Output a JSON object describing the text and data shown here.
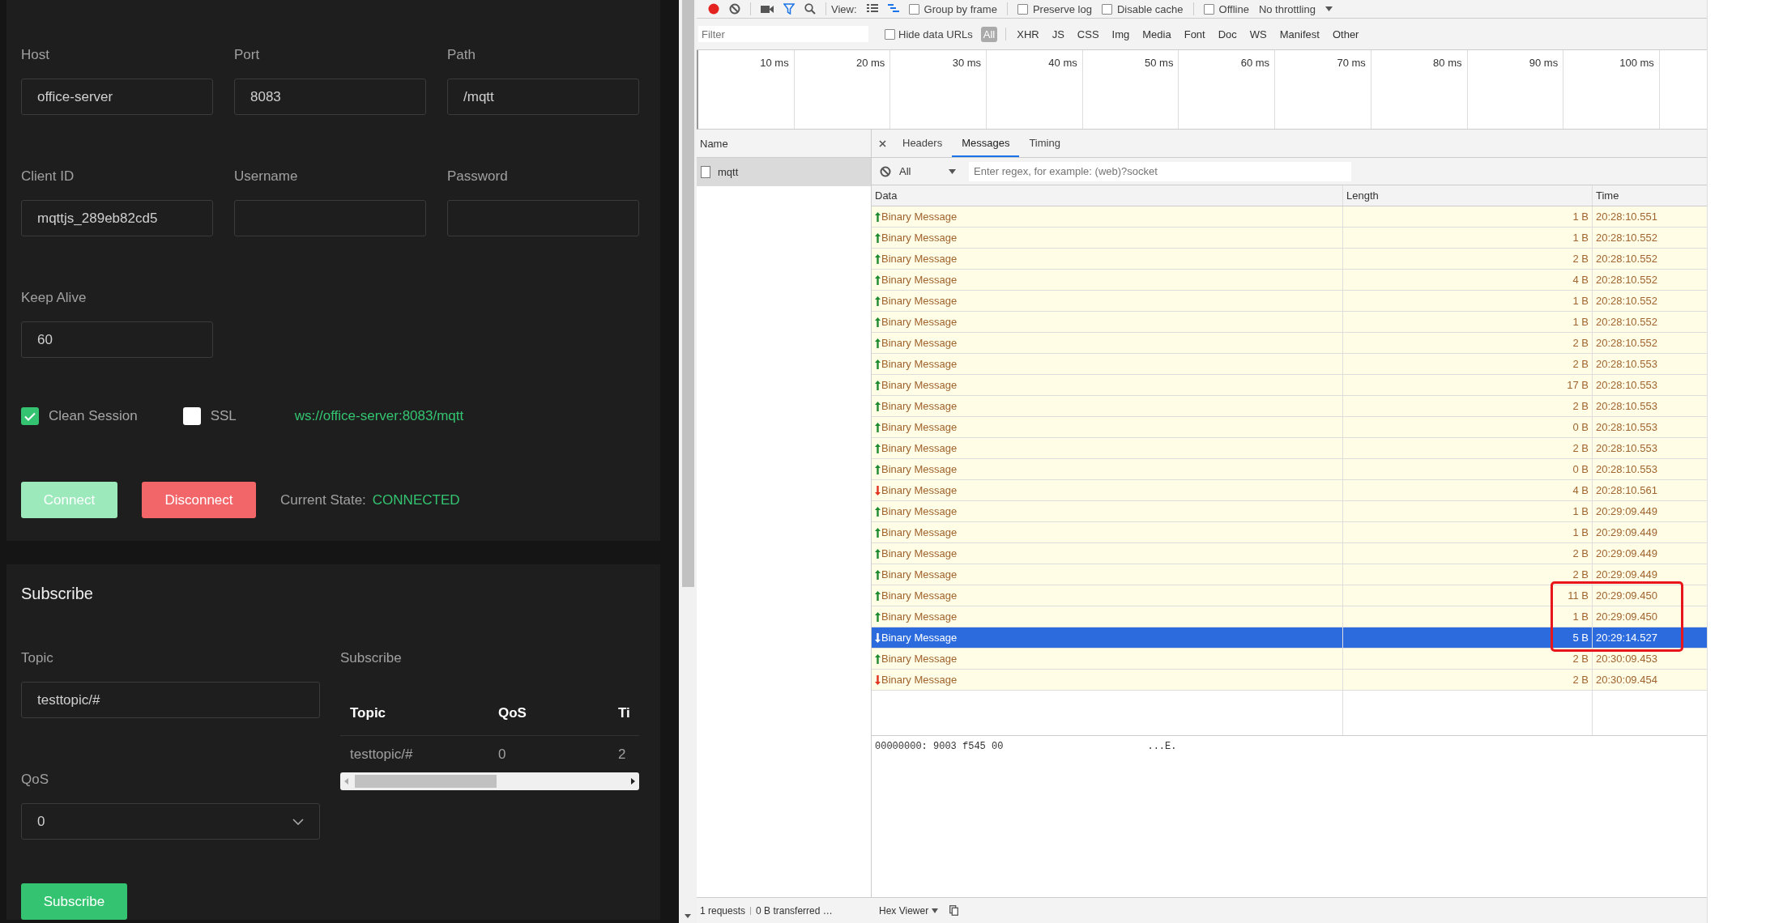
{
  "connection": {
    "fields": [
      {
        "label": "Host",
        "value": "office-server"
      },
      {
        "label": "Port",
        "value": "8083"
      },
      {
        "label": "Path",
        "value": "/mqtt"
      },
      {
        "label": "Client ID",
        "value": "mqttjs_289eb82cd5"
      },
      {
        "label": "Username"
      },
      {
        "label": "Password"
      },
      {
        "label": "Keep Alive",
        "value": "60"
      }
    ],
    "options": [
      {
        "label": "Clean Session",
        "checked": true
      },
      {
        "label": "SSL",
        "checked": false
      }
    ],
    "url": "ws://office-server:8083/mqtt",
    "buttons": [
      {
        "label": "Connect",
        "kind": "connect",
        "disabled": true
      },
      {
        "label": "Disconnect",
        "kind": "disconnect",
        "disabled": false
      }
    ],
    "state_label": "Current State:",
    "state": "CONNECTED"
  },
  "subscribe": {
    "title": "Subscribe",
    "topic": {
      "label": "Topic",
      "value": "testtopic/#"
    },
    "qos": {
      "label": "QoS",
      "value": "0"
    },
    "button": "Subscribe",
    "list": {
      "title": "Subscribe",
      "columns": [
        "Topic",
        "QoS",
        "Ti"
      ],
      "rows": [
        [
          "testtopic/#",
          "0",
          "2"
        ]
      ]
    }
  },
  "devtools": {
    "toolbar": {
      "recording": true,
      "view_label": "View:",
      "options": [
        {
          "label": "Group by frame",
          "checked": false
        },
        {
          "label": "Preserve log",
          "checked": false
        },
        {
          "label": "Disable cache",
          "checked": false
        },
        {
          "label": "Offline",
          "checked": false
        }
      ],
      "throttling": "No throttling"
    },
    "filter": {
      "placeholder": "Filter",
      "hide_data_urls": {
        "label": "Hide data URLs",
        "checked": false
      },
      "types": [
        {
          "label": "All",
          "selected": true
        },
        {
          "label": "XHR",
          "selected": false
        },
        {
          "label": "JS",
          "selected": false
        },
        {
          "label": "CSS",
          "selected": false
        },
        {
          "label": "Img",
          "selected": false
        },
        {
          "label": "Media",
          "selected": false
        },
        {
          "label": "Font",
          "selected": false
        },
        {
          "label": "Doc",
          "selected": false
        },
        {
          "label": "WS",
          "selected": false
        },
        {
          "label": "Manifest",
          "selected": false
        },
        {
          "label": "Other",
          "selected": false
        }
      ]
    },
    "timeline": {
      "ticks": [
        "10 ms",
        "20 ms",
        "30 ms",
        "40 ms",
        "50 ms",
        "60 ms",
        "70 ms",
        "80 ms",
        "90 ms",
        "100 ms"
      ]
    },
    "requests": {
      "column": "Name",
      "items": [
        {
          "name": "mqtt",
          "selected": true
        }
      ]
    },
    "tabs": [
      {
        "label": "Headers",
        "selected": false
      },
      {
        "label": "Messages",
        "selected": true
      },
      {
        "label": "Timing",
        "selected": false
      }
    ],
    "message_filter": {
      "type": "All",
      "placeholder": "Enter regex, for example: (web)?socket"
    },
    "columns": [
      "Data",
      "Length",
      "Time"
    ],
    "messages": [
      {
        "kind": "up",
        "data": "Binary Message",
        "length": "1 B",
        "time": "20:28:10.551",
        "selected": false,
        "marked": false
      },
      {
        "kind": "up",
        "data": "Binary Message",
        "length": "1 B",
        "time": "20:28:10.552",
        "selected": false,
        "marked": false
      },
      {
        "kind": "up",
        "data": "Binary Message",
        "length": "2 B",
        "time": "20:28:10.552",
        "selected": false,
        "marked": false
      },
      {
        "kind": "up",
        "data": "Binary Message",
        "length": "4 B",
        "time": "20:28:10.552",
        "selected": false,
        "marked": false
      },
      {
        "kind": "up",
        "data": "Binary Message",
        "length": "1 B",
        "time": "20:28:10.552",
        "selected": false,
        "marked": false
      },
      {
        "kind": "up",
        "data": "Binary Message",
        "length": "1 B",
        "time": "20:28:10.552",
        "selected": false,
        "marked": false
      },
      {
        "kind": "up",
        "data": "Binary Message",
        "length": "2 B",
        "time": "20:28:10.552",
        "selected": false,
        "marked": false
      },
      {
        "kind": "up",
        "data": "Binary Message",
        "length": "2 B",
        "time": "20:28:10.553",
        "selected": false,
        "marked": false
      },
      {
        "kind": "up",
        "data": "Binary Message",
        "length": "17 B",
        "time": "20:28:10.553",
        "selected": false,
        "marked": false
      },
      {
        "kind": "up",
        "data": "Binary Message",
        "length": "2 B",
        "time": "20:28:10.553",
        "selected": false,
        "marked": false
      },
      {
        "kind": "up",
        "data": "Binary Message",
        "length": "0 B",
        "time": "20:28:10.553",
        "selected": false,
        "marked": false
      },
      {
        "kind": "up",
        "data": "Binary Message",
        "length": "2 B",
        "time": "20:28:10.553",
        "selected": false,
        "marked": false
      },
      {
        "kind": "up",
        "data": "Binary Message",
        "length": "0 B",
        "time": "20:28:10.553",
        "selected": false,
        "marked": false
      },
      {
        "kind": "down",
        "data": "Binary Message",
        "length": "4 B",
        "time": "20:28:10.561",
        "selected": false,
        "marked": false
      },
      {
        "kind": "up",
        "data": "Binary Message",
        "length": "1 B",
        "time": "20:29:09.449",
        "selected": false,
        "marked": false
      },
      {
        "kind": "up",
        "data": "Binary Message",
        "length": "1 B",
        "time": "20:29:09.449",
        "selected": false,
        "marked": false
      },
      {
        "kind": "up",
        "data": "Binary Message",
        "length": "2 B",
        "time": "20:29:09.449",
        "selected": false,
        "marked": false
      },
      {
        "kind": "up",
        "data": "Binary Message",
        "length": "2 B",
        "time": "20:29:09.449",
        "selected": false,
        "marked": false
      },
      {
        "kind": "up",
        "data": "Binary Message",
        "length": "11 B",
        "time": "20:29:09.450",
        "selected": false,
        "marked": true
      },
      {
        "kind": "up",
        "data": "Binary Message",
        "length": "1 B",
        "time": "20:29:09.450",
        "selected": false,
        "marked": true
      },
      {
        "kind": "down",
        "data": "Binary Message",
        "length": "5 B",
        "time": "20:29:14.527",
        "selected": true,
        "marked": true
      },
      {
        "kind": "up",
        "data": "Binary Message",
        "length": "2 B",
        "time": "20:30:09.453",
        "selected": false,
        "marked": false
      },
      {
        "kind": "down",
        "data": "Binary Message",
        "length": "2 B",
        "time": "20:30:09.454",
        "selected": false,
        "marked": false
      }
    ],
    "hex": {
      "line": "00000000: 9003 f545 00",
      "ascii": "...E."
    },
    "status": {
      "requests": "1 requests",
      "transferred": "0 B transferred …"
    },
    "viewer": "Hex Viewer"
  }
}
